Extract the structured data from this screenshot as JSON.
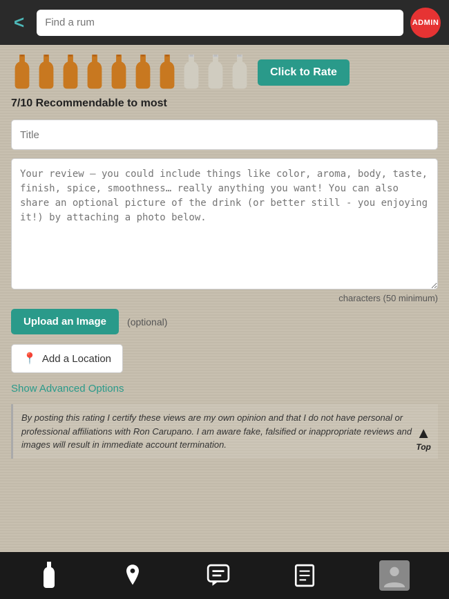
{
  "topBar": {
    "backLabel": "<",
    "searchPlaceholder": "Find a rum",
    "adminLabel": "ADMIN"
  },
  "rating": {
    "bottles": [
      {
        "filled": true
      },
      {
        "filled": true
      },
      {
        "filled": true
      },
      {
        "filled": true
      },
      {
        "filled": true
      },
      {
        "filled": true
      },
      {
        "filled": true
      },
      {
        "filled": false
      },
      {
        "filled": false
      },
      {
        "filled": false
      }
    ],
    "clickToRateLabel": "Click to Rate",
    "ratingText": "7/10 Recommendable to most"
  },
  "form": {
    "titlePlaceholder": "Title",
    "reviewPlaceholder": "Your review – you could include things like color, aroma, body, taste, finish, spice, smoothness… really anything you want! You can also share an optional picture of the drink (or better still - you enjoying it!) by attaching a photo below.",
    "charsLabel": "characters (50 minimum)",
    "uploadLabel": "Upload an Image",
    "optionalLabel": "(optional)",
    "locationLabel": "Add a Location",
    "advancedOptionsLabel": "Show Advanced Options",
    "disclaimerText": "By posting this rating I certify these views are my own opinion and that I do not have personal or professional affiliations with Ron Carupano. I am aware fake, falsified or inappropriate reviews and images will result in immediate account termination.",
    "topLabel": "Top"
  },
  "bottomNav": {
    "items": [
      {
        "name": "bottle",
        "icon": "🍾"
      },
      {
        "name": "location",
        "icon": "📍"
      },
      {
        "name": "chat",
        "icon": "💬"
      },
      {
        "name": "news",
        "icon": "📋"
      },
      {
        "name": "profile",
        "icon": "👤"
      }
    ]
  }
}
